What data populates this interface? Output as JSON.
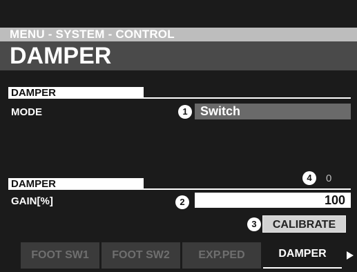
{
  "header": {
    "breadcrumb": "MENU - SYSTEM - CONTROL",
    "title": "DAMPER"
  },
  "section1": {
    "tab": "DAMPER",
    "mode_label": "MODE",
    "mode_badge": "1",
    "mode_value": "Switch"
  },
  "section2": {
    "tab": "DAMPER",
    "indicator_badge": "4",
    "indicator_value": "0",
    "gain_label": "GAIN[%]",
    "gain_badge": "2",
    "gain_value": "100",
    "calibrate_badge": "3",
    "calibrate_label": "CALIBRATE"
  },
  "tabs": [
    {
      "label": "FOOT SW1",
      "active": false
    },
    {
      "label": "FOOT SW2",
      "active": false
    },
    {
      "label": "EXP.PED",
      "active": false
    },
    {
      "label": "DAMPER",
      "active": true
    }
  ],
  "icons": {
    "next": "triangle-right-icon"
  },
  "colors": {
    "header_bar": "#bdbdbd",
    "title_bar": "#4a4a4a",
    "background": "#1b1b1b"
  }
}
